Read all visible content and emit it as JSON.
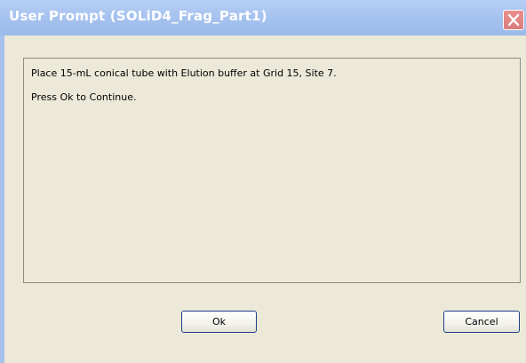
{
  "window": {
    "title": "User Prompt (SOLiD4_Frag_Part1)",
    "close_icon": "close-icon"
  },
  "message": {
    "line1": "Place 15-mL conical tube with Elution buffer at Grid 15, Site 7.",
    "line2": "Press Ok to Continue."
  },
  "buttons": {
    "ok_label": "Ok",
    "cancel_label": "Cancel"
  },
  "colors": {
    "titlebar": "#a7c3ef",
    "close_button": "#da7d7d",
    "dialog_background": "#ece9d8",
    "button_border": "#1e3f8a"
  }
}
